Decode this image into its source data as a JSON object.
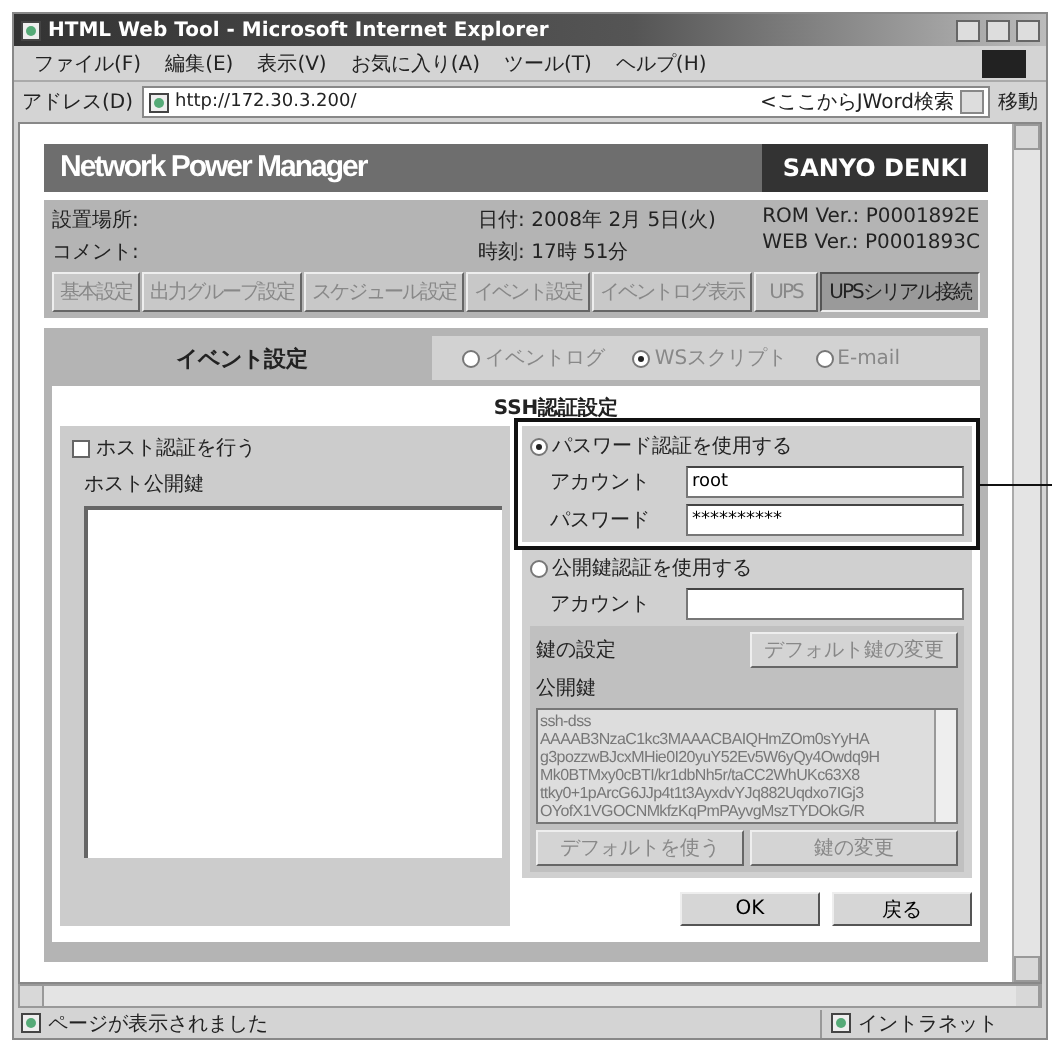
{
  "window": {
    "title": "HTML Web Tool - Microsoft Internet Explorer"
  },
  "menu": [
    "ファイル(F)",
    "編集(E)",
    "表示(V)",
    "お気に入り(A)",
    "ツール(T)",
    "ヘルプ(H)"
  ],
  "address_bar": {
    "label": "アドレス(D)",
    "url": "http://172.30.3.200/",
    "search": "<ここからJWord検索",
    "go": "移動"
  },
  "page": {
    "brand": "Network Power Manager",
    "vendor": "SANYO DENKI",
    "info": [
      [
        "設置場所:",
        "コメント:"
      ],
      [
        "日付: 2008年 2月 5日(火)",
        "時刻: 17時 51分"
      ],
      [
        "ROM Ver.: P0001892E",
        "WEB Ver.: P0001893C"
      ]
    ],
    "tabs": [
      {
        "label": "基本設定",
        "selected": false
      },
      {
        "label": "出力グループ設定",
        "selected": false
      },
      {
        "label": "スケジュール設定",
        "selected": false
      },
      {
        "label": "イベント設定",
        "selected": false
      },
      {
        "label": "イベントログ表示",
        "selected": false
      },
      {
        "label": "UPS",
        "selected": false
      },
      {
        "label": "UPSシリアル接続",
        "selected": true
      }
    ],
    "section": {
      "title": "イベント設定",
      "modes": [
        {
          "label": "イベントログ",
          "selected": false
        },
        {
          "label": "WSスクリプト",
          "selected": true
        },
        {
          "label": "E-mail",
          "selected": false
        }
      ]
    },
    "ssh": {
      "title": "SSH認証設定",
      "host_auth": {
        "label": "ホスト認証を行う",
        "checked": false
      },
      "host_key_label": "ホスト公開鍵",
      "password_auth": {
        "label": "パスワード認証を使用する",
        "selected": true,
        "fields": [
          {
            "label": "アカウント",
            "value": "root"
          },
          {
            "label": "パスワード",
            "value": "**********"
          }
        ]
      },
      "pubkey_auth": {
        "label": "公開鍵認証を使用する",
        "selected": false,
        "account_label": "アカウント",
        "key_settings": "鍵の設定",
        "default_key_change": "デフォルト鍵の変更",
        "public_key_label": "公開鍵",
        "public_key": [
          "ssh-dss",
          "AAAAB3NzaC1kc3MAAACBAIQHmZOm0sYyHA",
          "g3pozzwBJcxMHie0I20yuY52Ev5W6yQy4Owdq9H",
          "Mk0BTMxy0cBTI/kr1dbNh5r/taCC2WhUKc63X8",
          "ttky0+1pArcG6JJp4t1t3AyxdvYJq882Uqdxo7IGj3",
          "OYofX1VGOCNMkfzKqPmPAyvgMszTYDOkG/R"
        ],
        "use_default": "デフォルトを使う",
        "change_key": "鍵の変更"
      }
    },
    "buttons": [
      "OK",
      "戻る"
    ]
  },
  "status_bar": {
    "text": "ページが表示されました",
    "zone": "イントラネット"
  }
}
